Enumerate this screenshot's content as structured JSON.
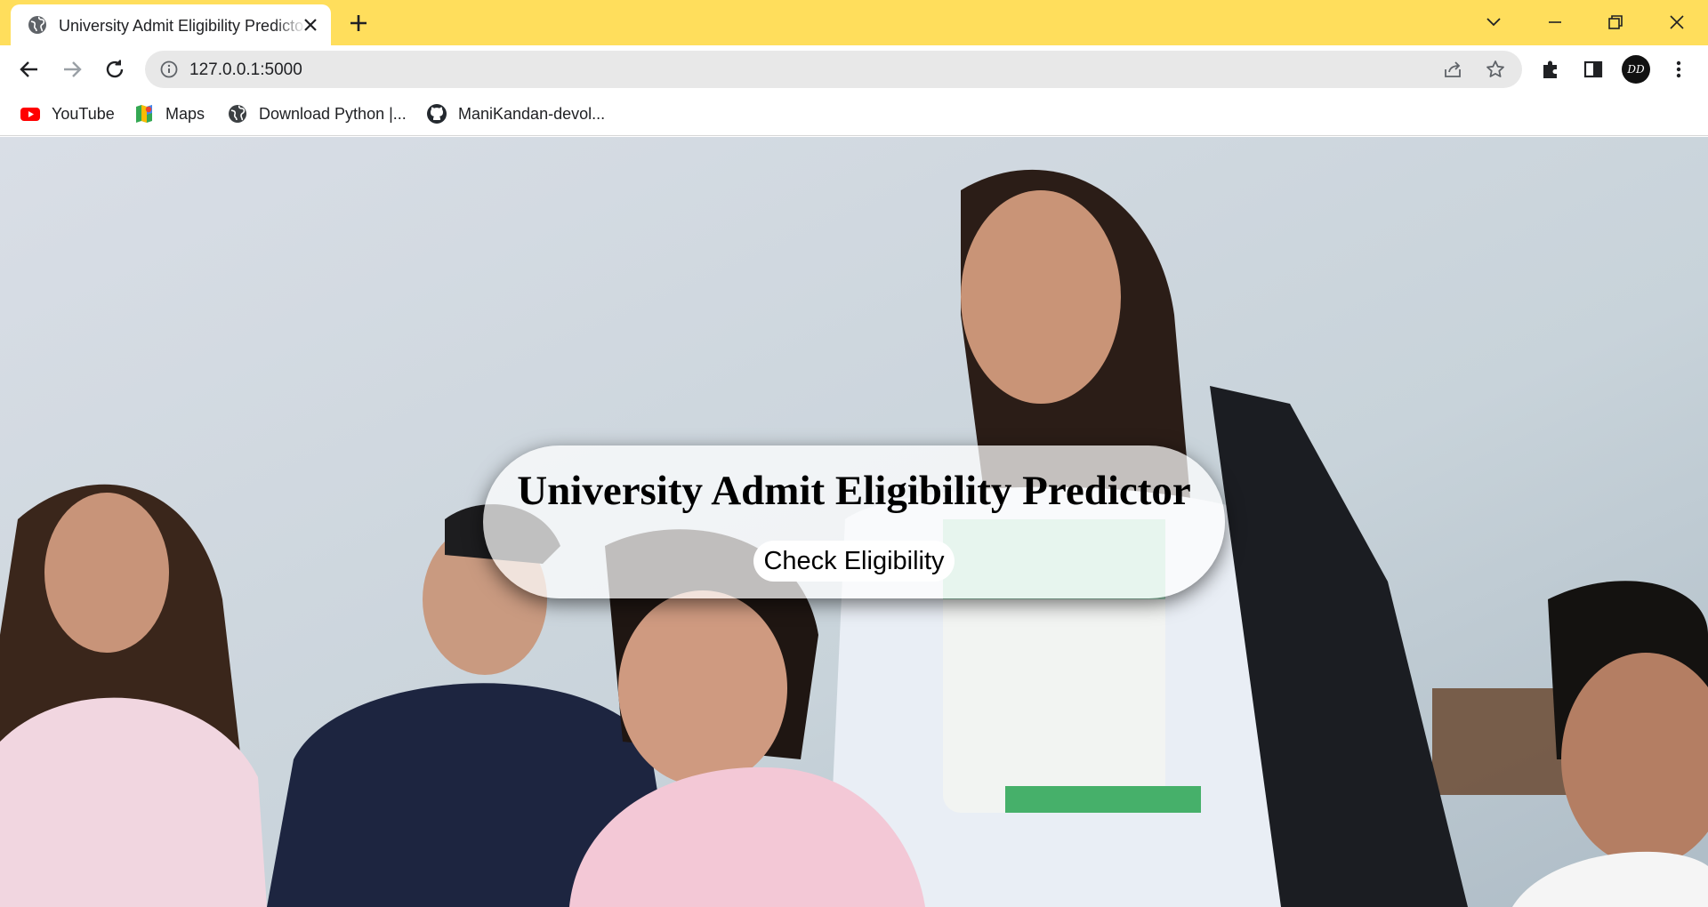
{
  "browser": {
    "tab": {
      "title": "University Admit Eligibility Predictor"
    },
    "address_bar": {
      "url": "127.0.0.1:5000"
    },
    "bookmarks": [
      {
        "label": "YouTube",
        "icon": "youtube-icon"
      },
      {
        "label": "Maps",
        "icon": "maps-icon"
      },
      {
        "label": "Download Python |...",
        "icon": "globe-icon"
      },
      {
        "label": "ManiKandan-devol...",
        "icon": "github-icon"
      }
    ],
    "avatar_initials": "DD",
    "theme_color": "#ffde5c"
  },
  "page": {
    "title": "University Admit Eligibility Predictor",
    "button_label": "Check Eligibility",
    "background": "photo of students in a classroom"
  }
}
